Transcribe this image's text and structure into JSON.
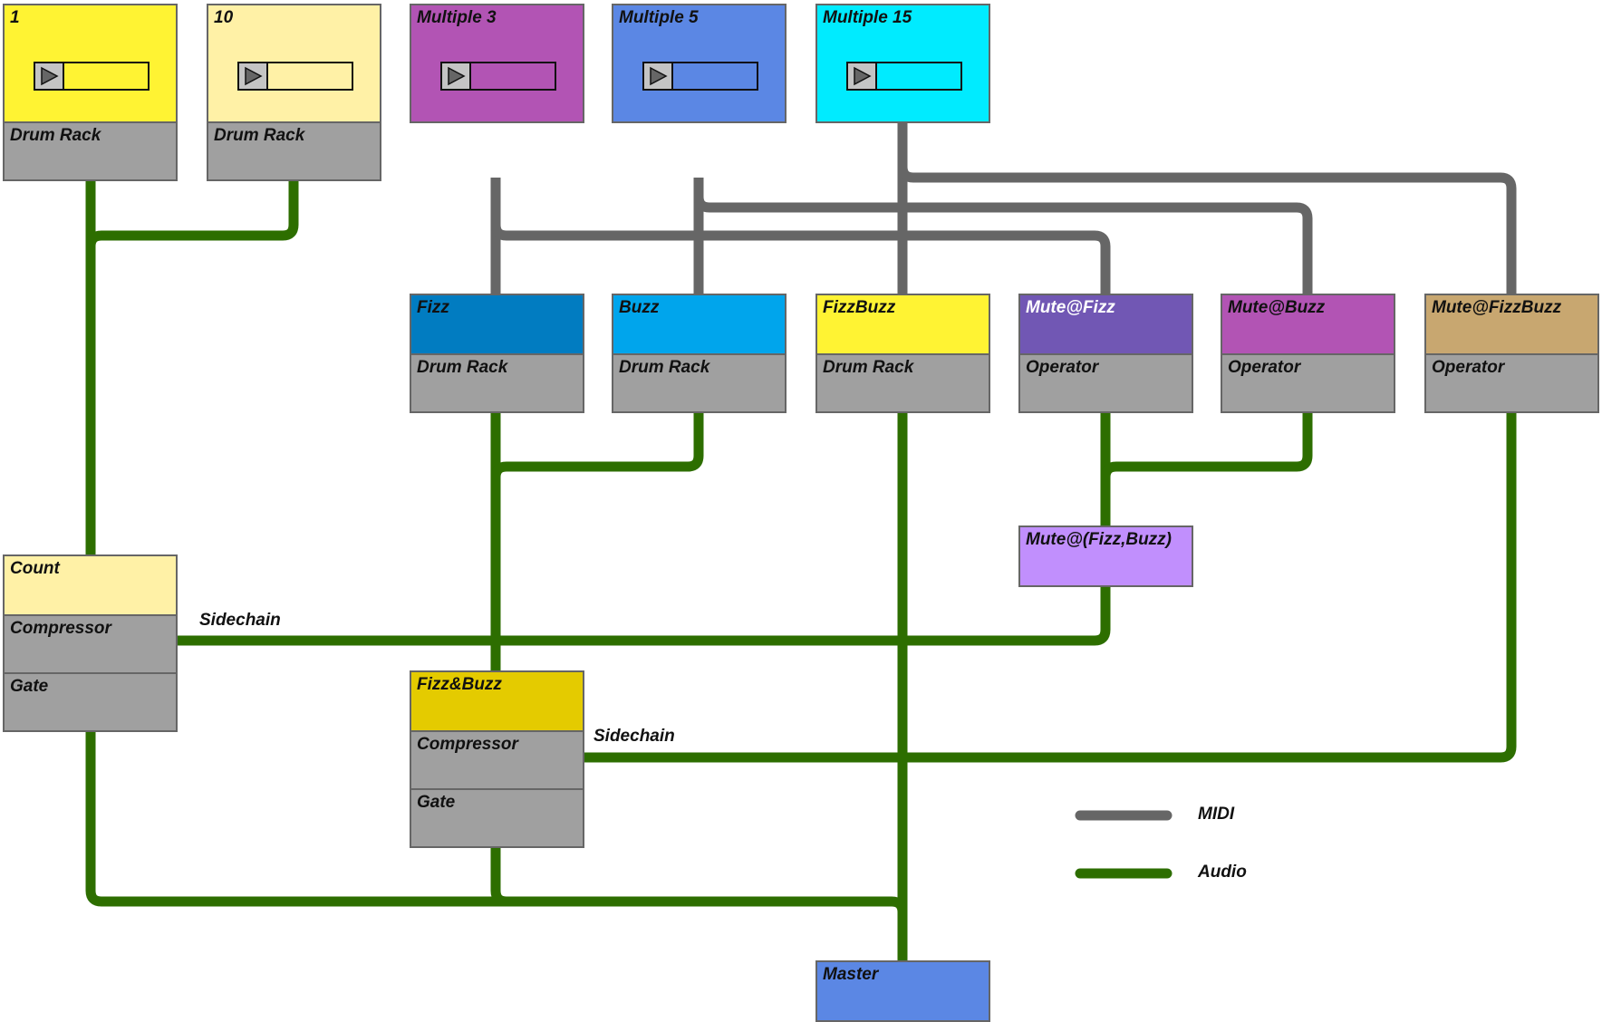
{
  "colors": {
    "midi": "#666666",
    "audio": "#2d6e00",
    "device": "#a0a0a0",
    "border": "#666666"
  },
  "clips": [
    {
      "id": "clip-1",
      "title": "1",
      "device": "Drum Rack",
      "color": "#fff333"
    },
    {
      "id": "clip-10",
      "title": "10",
      "device": "Drum Rack",
      "color": "#fff1a6"
    },
    {
      "id": "multiple-3",
      "title": "Multiple 3",
      "color": "#b254b4"
    },
    {
      "id": "multiple-5",
      "title": "Multiple 5",
      "color": "#5b87e4"
    },
    {
      "id": "multiple-15",
      "title": "Multiple 15",
      "color": "#00ebff"
    }
  ],
  "tracks": [
    {
      "id": "fizz",
      "title": "Fizz",
      "device": "Drum Rack",
      "color": "#017cc1",
      "text": "dark"
    },
    {
      "id": "buzz",
      "title": "Buzz",
      "device": "Drum Rack",
      "color": "#00a5ec",
      "text": "dark"
    },
    {
      "id": "fizzbuzz",
      "title": "FizzBuzz",
      "device": "Drum Rack",
      "color": "#fff333",
      "text": "dark"
    },
    {
      "id": "mute-fizz",
      "title": "Mute@Fizz",
      "device": "Operator",
      "color": "#7157b4",
      "text": "light"
    },
    {
      "id": "mute-buzz",
      "title": "Mute@Buzz",
      "device": "Operator",
      "color": "#b254b4",
      "text": "dark"
    },
    {
      "id": "mute-fizzbuzz",
      "title": "Mute@FizzBuzz",
      "device": "Operator",
      "color": "#c8a770",
      "text": "dark"
    }
  ],
  "groups": {
    "mute_fizz_buzz": {
      "title": "Mute@(Fizz,Buzz)",
      "color": "#c18ffd"
    },
    "count": {
      "title": "Count",
      "devices": [
        "Compressor",
        "Gate"
      ],
      "color": "#fff1a6"
    },
    "fizz_and_buzz": {
      "title": "Fizz&Buzz",
      "devices": [
        "Compressor",
        "Gate"
      ],
      "color": "#e4cb00"
    },
    "master": {
      "title": "Master",
      "color": "#5b87e4"
    }
  },
  "annotations": {
    "sidechain_count": "Sidechain",
    "sidechain_fizz_and_buzz": "Sidechain"
  },
  "legend": [
    {
      "label": "MIDI",
      "kind": "midi"
    },
    {
      "label": "Audio",
      "kind": "audio"
    }
  ]
}
